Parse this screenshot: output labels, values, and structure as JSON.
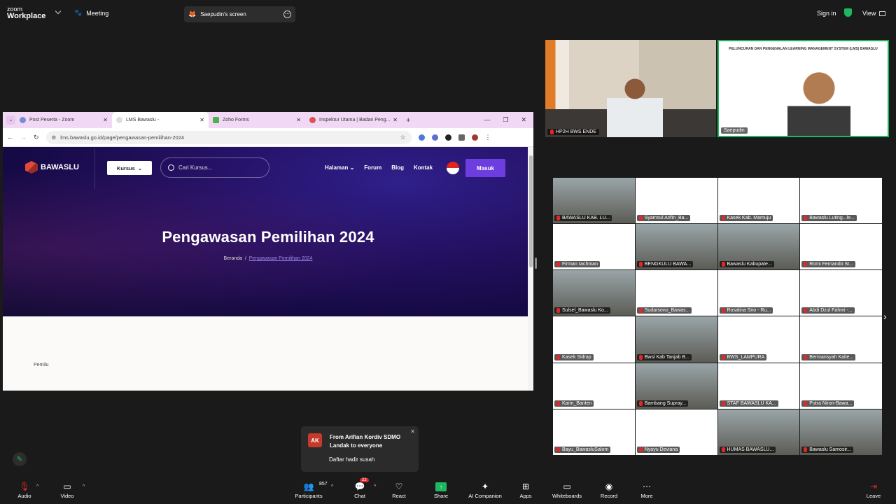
{
  "app": {
    "brand_top": "zoom",
    "brand_bottom": "Workplace",
    "meeting_label": "Meeting",
    "share_label": "Saepudin's screen",
    "signin": "Sign in",
    "view": "View"
  },
  "browser": {
    "tabs": [
      {
        "label": "Post Peserta - Zoom"
      },
      {
        "label": "LMS Bawaslu -"
      },
      {
        "label": "Zoho Forms"
      },
      {
        "label": "Inspektur Utama | Badan Peng..."
      }
    ],
    "url": "lms.bawaslu.go.id/page/pengawasan-pemilihan-2024"
  },
  "site": {
    "brand": "BAWASLU",
    "kursus": "Kursus",
    "search_placeholder": "Cari Kursus...",
    "menu": [
      "Halaman",
      "Forum",
      "Blog",
      "Kontak"
    ],
    "login": "Masuk",
    "hero_title": "Pengawasan Pemilihan 2024",
    "breadcrumb_home": "Beranda",
    "breadcrumb_sep": "/",
    "breadcrumb_current": "Pengawasan Pemilihan 2024",
    "body_text": "Pemilu"
  },
  "speakers": [
    {
      "name": "HP2H BWS ENDE"
    },
    {
      "name": "Saepudin",
      "slide_title": "PELUNCURAN DAN PENGENALAN LEARNING MANAGEMENT SYSTEM (LMS) BAWASLU"
    }
  ],
  "gallery": [
    "BAWASLU KAB. LU...",
    "Syamsul Arifin_Ba...",
    "Kasek Kab. Mamuju",
    "Bawaslu Luting...le...",
    "Firman rachman",
    "BENGKULU BAWA...",
    "Bawaslu Kabupate...",
    "Romi Fernando St...",
    "Sulsel_Bawaslu Ko...",
    "Sudarsono_Bawas...",
    "Rosalina Sno - Ru...",
    "Abdi Dzul Fahmi -...",
    "Kasek Sidrap",
    "Bwsl Kab Tanjab B...",
    "BWS_LAMPURA",
    "Bermansyah Kaite...",
    "Karin_Banten",
    "Bambang Supray...",
    "STAF BAWASLU KA...",
    "Putra Niron-Bawa...",
    "Bayu_BawasluSalom",
    "Nyayu Deviana",
    "HUMAS BAWASLU...",
    "Bawaslu Samosir..."
  ],
  "notification": {
    "avatar": "AK",
    "from": "From Arifian Kordiv SDMO Landak to everyone",
    "message": "Daftar hadir susah"
  },
  "toolbar": {
    "audio": "Audio",
    "video": "Video",
    "participants": "Participants",
    "participants_count": "857",
    "chat": "Chat",
    "chat_badge": "22",
    "react": "React",
    "share": "Share",
    "ai": "AI Companion",
    "apps": "Apps",
    "whiteboards": "Whiteboards",
    "record": "Record",
    "more": "More",
    "leave": "Leave"
  }
}
